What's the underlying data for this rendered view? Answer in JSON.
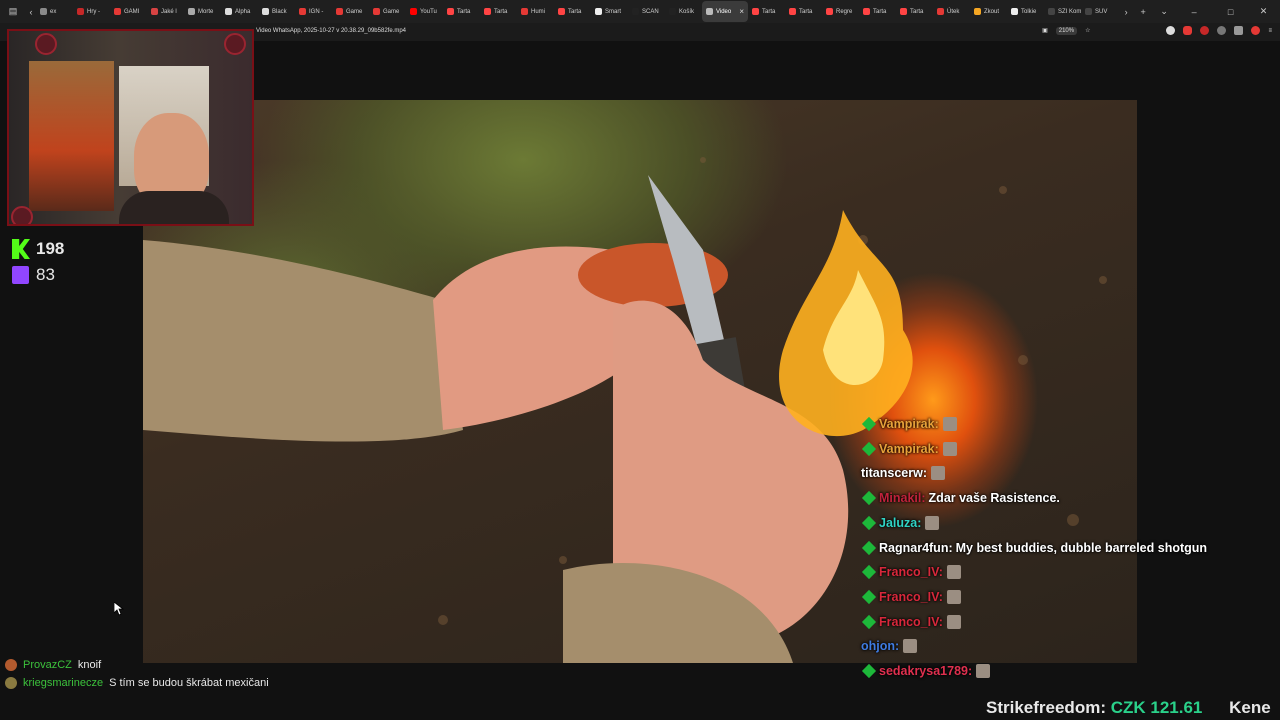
{
  "tabs": [
    {
      "label": "ex",
      "color": "#8a8a8a"
    },
    {
      "label": "Hry -",
      "color": "#c62828"
    },
    {
      "label": "GAMI",
      "color": "#e53935"
    },
    {
      "label": "Jaké l",
      "color": "#d84343"
    },
    {
      "label": "Morte",
      "color": "#aaaaaa"
    },
    {
      "label": "Alpha",
      "color": "#dddddd"
    },
    {
      "label": "Black",
      "color": "#dddddd"
    },
    {
      "label": "IGN -",
      "color": "#e53935"
    },
    {
      "label": "Game",
      "color": "#e53935"
    },
    {
      "label": "Game",
      "color": "#e53935"
    },
    {
      "label": "YouTu",
      "color": "#ff0000"
    },
    {
      "label": "Tarta",
      "color": "#ff4444"
    },
    {
      "label": "Tarta",
      "color": "#ff4444"
    },
    {
      "label": "Humi",
      "color": "#e53935"
    },
    {
      "label": "Tarta",
      "color": "#ff4444"
    },
    {
      "label": "Smart",
      "color": "#eeeeee"
    },
    {
      "label": "SCAN",
      "color": "#222222"
    },
    {
      "label": "Košík",
      "color": "#222222"
    },
    {
      "label": "Video",
      "color": "#bbbbbb"
    },
    {
      "label": "Tarta",
      "color": "#ff4444"
    },
    {
      "label": "Tarta",
      "color": "#ff4444"
    },
    {
      "label": "Regre",
      "color": "#ff4444"
    },
    {
      "label": "Tarta",
      "color": "#ff4444"
    },
    {
      "label": "Tarta",
      "color": "#ff4444"
    },
    {
      "label": "Útek",
      "color": "#e53935"
    },
    {
      "label": "Zkout",
      "color": "#f5a623"
    },
    {
      "label": "Tolkie",
      "color": "#eeeeee"
    },
    {
      "label": "SZI Komu",
      "color": "#444444"
    },
    {
      "label": "SUV",
      "color": "#444444"
    }
  ],
  "active_tab_index": 18,
  "url": "Video WhatsApp, 2025-10-27 v 20.38.29_09b582fe.mp4",
  "zoom": "210%",
  "stats": {
    "kick": "198",
    "twitch": "83"
  },
  "overlay_chat": [
    {
      "user": "Vampirak:",
      "color": "#e8a23a",
      "msg": "",
      "emote": true,
      "badge": true
    },
    {
      "user": "Vampirak:",
      "color": "#e8a23a",
      "msg": "",
      "emote": true,
      "badge": true
    },
    {
      "user": "titanscerw:",
      "color": "#ffffff",
      "msg": "",
      "emote": true,
      "badge": false
    },
    {
      "user": "Minakil:",
      "color": "#c0223b",
      "msg": "Zdar vaše Rasistence.",
      "emote": false,
      "badge": true
    },
    {
      "user": "Jaluza:",
      "color": "#2fd3c4",
      "msg": "",
      "emote": true,
      "badge": true
    },
    {
      "user": "Ragnar4fun:",
      "color": "#ffffff",
      "msg": "My best buddies, dubble barreled shotgun",
      "emote": false,
      "badge": true
    },
    {
      "user": "Franco_IV:",
      "color": "#d8283b",
      "msg": "",
      "emote": true,
      "badge": true
    },
    {
      "user": "Franco_IV:",
      "color": "#d8283b",
      "msg": "",
      "emote": true,
      "badge": true
    },
    {
      "user": "Franco_IV:",
      "color": "#d8283b",
      "msg": "",
      "emote": true,
      "badge": true
    },
    {
      "user": "ohjon:",
      "color": "#3f7be0",
      "msg": "",
      "emote": true,
      "badge": false
    },
    {
      "user": "sedakrysa1789:",
      "color": "#e0304f",
      "msg": "",
      "emote": true,
      "badge": true
    }
  ],
  "bottom_chat": [
    {
      "user": "ProvazCZ",
      "color": "#3cc23c",
      "msg": "knoif",
      "avatar": "#b35a2e"
    },
    {
      "user": "kriegsmarinecze",
      "color": "#3cc23c",
      "msg": "S tím se budou škrábat mexičani",
      "avatar": "#8a7a40"
    }
  ],
  "donation": {
    "name": "Strikefreedom:",
    "amount": "CZK 121.61",
    "next": "Kene"
  },
  "colors": {
    "accent_red": "#7a0f16",
    "kick_green": "#53fc18",
    "twitch_purple": "#9146ff",
    "donation_green": "#2ad18a"
  }
}
